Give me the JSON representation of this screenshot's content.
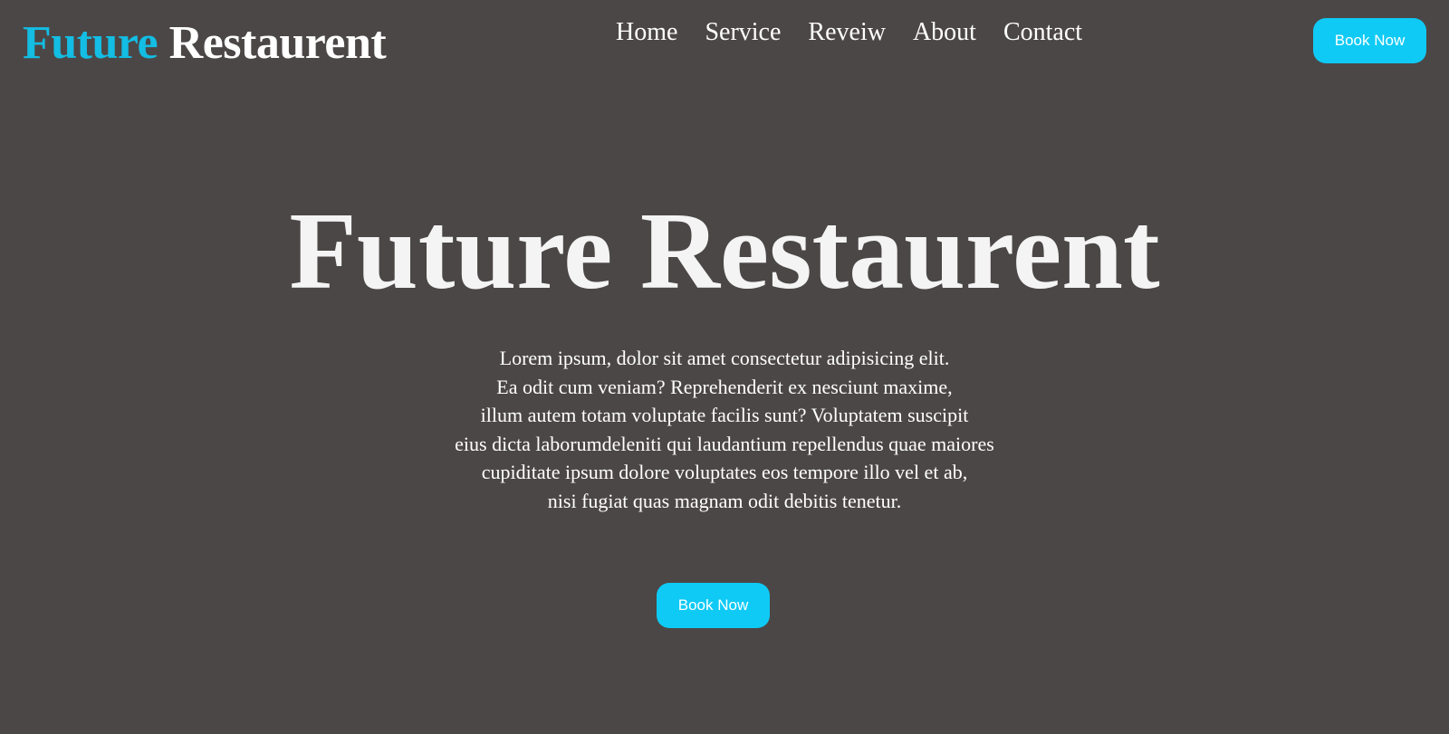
{
  "header": {
    "logo_accent": "Future",
    "logo_rest": "Restaurent",
    "nav": [
      {
        "label": "Home"
      },
      {
        "label": "Service"
      },
      {
        "label": "Reveiw"
      },
      {
        "label": "About"
      },
      {
        "label": "Contact"
      }
    ],
    "book_label": "Book Now"
  },
  "hero": {
    "title": "Future Restaurent",
    "lines": [
      "Lorem ipsum, dolor sit amet consectetur adipisicing elit.",
      "Ea odit cum veniam? Reprehenderit ex nesciunt maxime,",
      "illum autem totam voluptate facilis sunt? Voluptatem suscipit",
      "eius dicta laborumdeleniti qui laudantium repellendus quae maiores",
      "cupiditate ipsum dolore voluptates eos tempore illo vel et ab,",
      "nisi fugiat quas magnam odit debitis tenetur."
    ],
    "book_label": "Book Now"
  },
  "colors": {
    "background": "#4c4747",
    "accent": "#13bde3",
    "button": "#0fcaf5",
    "text": "#ffffff"
  }
}
